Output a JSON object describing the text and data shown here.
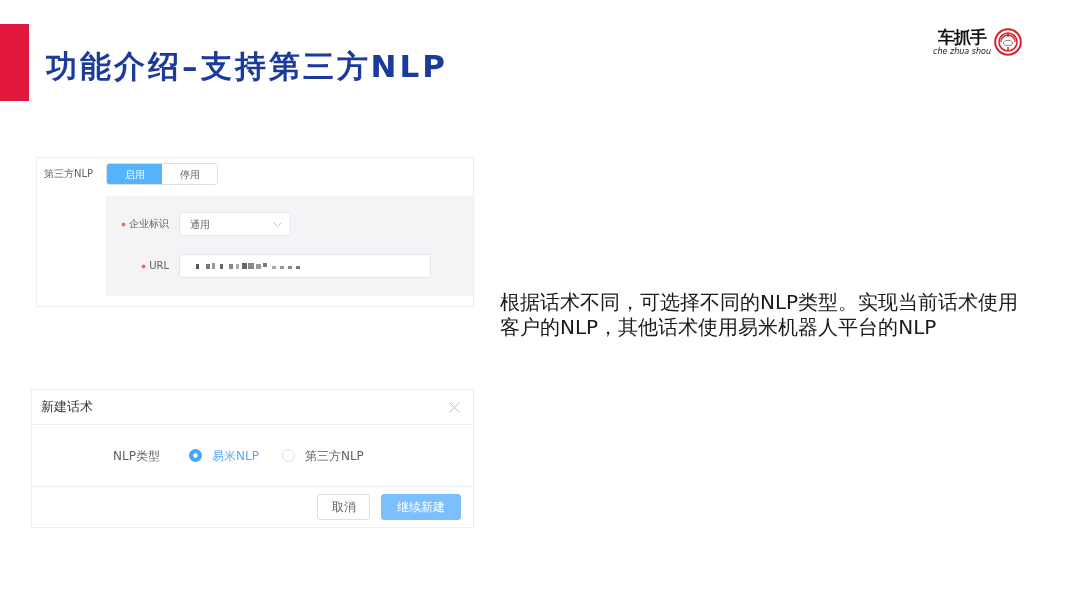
{
  "slide": {
    "title": "功能介绍–支持第三方NLP"
  },
  "logo": {
    "name": "车抓手",
    "pinyin": "che zhua shou"
  },
  "settings_panel": {
    "label": "第三方NLP",
    "toggle": [
      {
        "label": "启用",
        "selected": true
      },
      {
        "label": "停用",
        "selected": false
      }
    ],
    "fields": [
      {
        "kind": "select",
        "label": "企业标识",
        "required": true,
        "value": "通用"
      },
      {
        "kind": "input",
        "label": "URL",
        "required": true,
        "blurred": true
      }
    ]
  },
  "dialog": {
    "title": "新建话术",
    "field_label": "NLP类型",
    "options": [
      {
        "label": "易米NLP",
        "selected": true
      },
      {
        "label": "第三方NLP",
        "selected": false
      }
    ],
    "buttons": [
      {
        "label": "取消",
        "kind": "secondary"
      },
      {
        "label": "继续新建",
        "kind": "primary"
      }
    ]
  },
  "description": "根据话术不同，可选择不同的NLP类型。实现当前话术使用客户的NLP，其他话术使用易米机器人平台的NLP"
}
